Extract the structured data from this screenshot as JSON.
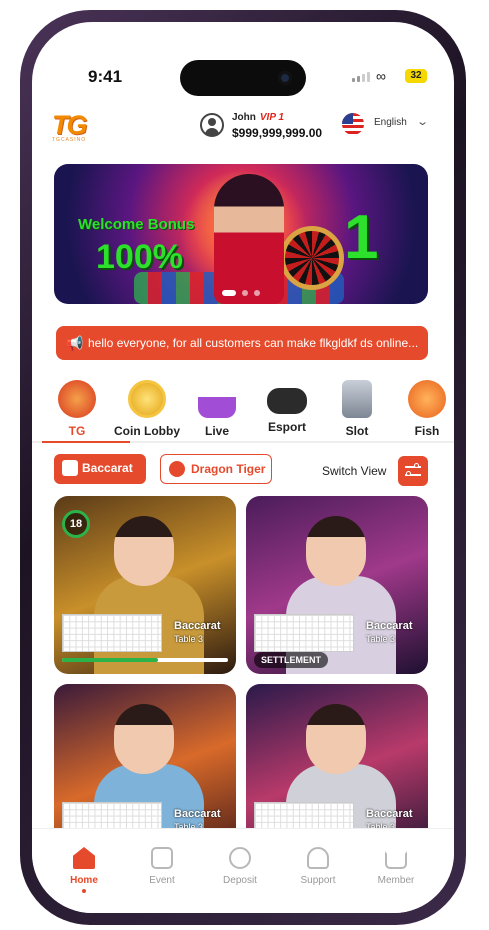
{
  "status": {
    "time": "9:41",
    "battery": "32"
  },
  "header": {
    "logo_text": "TG",
    "logo_sub": "TGCASINO",
    "username": "John",
    "vip": "VIP 1",
    "balance": "$999,999,999.00",
    "language": "English"
  },
  "banner": {
    "line1": "Welcome Bonus",
    "line2": "100%",
    "line3": "1"
  },
  "marquee": {
    "text": "hello everyone, for all customers can make flkgldkf ds online..."
  },
  "categories": [
    {
      "label": "TG"
    },
    {
      "label": "Coin Lobby"
    },
    {
      "label": "Live"
    },
    {
      "label": "Esport"
    },
    {
      "label": "Slot"
    },
    {
      "label": "Fish"
    }
  ],
  "filters": {
    "baccarat": "Baccarat",
    "dragon_tiger": "Dragon Tiger",
    "switch_view": "Switch View"
  },
  "tables": [
    {
      "title": "Baccarat",
      "sub": "Table 3",
      "timer": "18",
      "progress": 0.58
    },
    {
      "title": "Baccarat",
      "sub": "Table 3",
      "status": "SETTLEMENT"
    },
    {
      "title": "Baccarat",
      "sub": "Table 3"
    },
    {
      "title": "Baccarat",
      "sub": "Table 3"
    }
  ],
  "tabbar": [
    {
      "label": "Home"
    },
    {
      "label": "Event"
    },
    {
      "label": "Deposit"
    },
    {
      "label": "Support"
    },
    {
      "label": "Member"
    }
  ],
  "colors": {
    "accent": "#e64a2c",
    "green": "#2bb34a"
  }
}
